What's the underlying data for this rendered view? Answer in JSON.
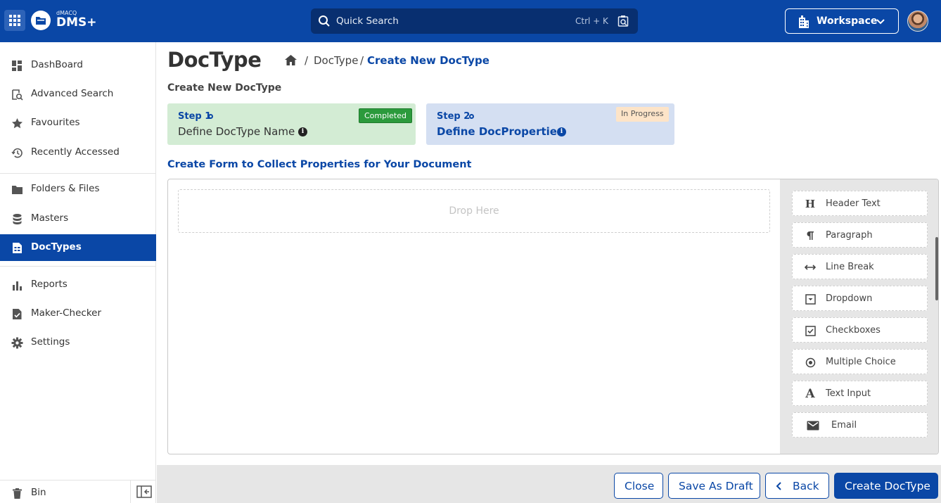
{
  "app": {
    "brand_small": "dMACQ",
    "brand_name": "DMS+"
  },
  "search": {
    "placeholder": "Quick Search",
    "shortcut": "Ctrl + K"
  },
  "workspace": {
    "label": "Workspace"
  },
  "sidebar": {
    "items": [
      {
        "label": "DashBoard",
        "icon": "dashboard-icon"
      },
      {
        "label": "Advanced Search",
        "icon": "advanced-search-icon"
      },
      {
        "label": "Favourites",
        "icon": "star-icon"
      },
      {
        "label": "Recently Accessed",
        "icon": "history-icon"
      },
      {
        "label": "Folders & Files",
        "icon": "folder-icon"
      },
      {
        "label": "Masters",
        "icon": "database-icon"
      },
      {
        "label": "DocTypes",
        "icon": "doctype-icon",
        "active": true
      },
      {
        "label": "Reports",
        "icon": "bar-chart-icon"
      },
      {
        "label": "Maker-Checker",
        "icon": "document-check-icon"
      },
      {
        "label": "Settings",
        "icon": "gear-icon"
      }
    ],
    "bin_label": "Bin"
  },
  "page": {
    "title": "DocType",
    "breadcrumb": {
      "item": "DocType",
      "separator": "/",
      "current": "Create New DocType"
    },
    "subtitle": "Create New DocType"
  },
  "steps": [
    {
      "number": "Step 1",
      "name": "Define DocType Name",
      "status": "Completed"
    },
    {
      "number": "Step 2",
      "name": "Define DocProperties",
      "status": "In Progress"
    }
  ],
  "form": {
    "heading": "Create Form to Collect Properties for Your Document",
    "drop_placeholder": "Drop Here"
  },
  "palette": [
    {
      "label": "Header Text",
      "icon": "header-icon"
    },
    {
      "label": "Paragraph",
      "icon": "paragraph-icon"
    },
    {
      "label": "Line Break",
      "icon": "line-break-icon"
    },
    {
      "label": "Dropdown",
      "icon": "dropdown-icon"
    },
    {
      "label": "Checkboxes",
      "icon": "checkbox-icon"
    },
    {
      "label": "Multiple Choice",
      "icon": "radio-icon"
    },
    {
      "label": "Text Input",
      "icon": "text-input-icon"
    },
    {
      "label": "Email",
      "icon": "email-icon"
    }
  ],
  "footer": {
    "close": "Close",
    "save_draft": "Save As Draft",
    "back": "Back",
    "create": "Create DocType"
  },
  "colors": {
    "primary": "#0a47a6",
    "completed": "#2b9a3c",
    "step1_bg": "#d3ecd4",
    "step2_bg": "#d4dff2",
    "in_progress_bg": "#fde4c8"
  }
}
